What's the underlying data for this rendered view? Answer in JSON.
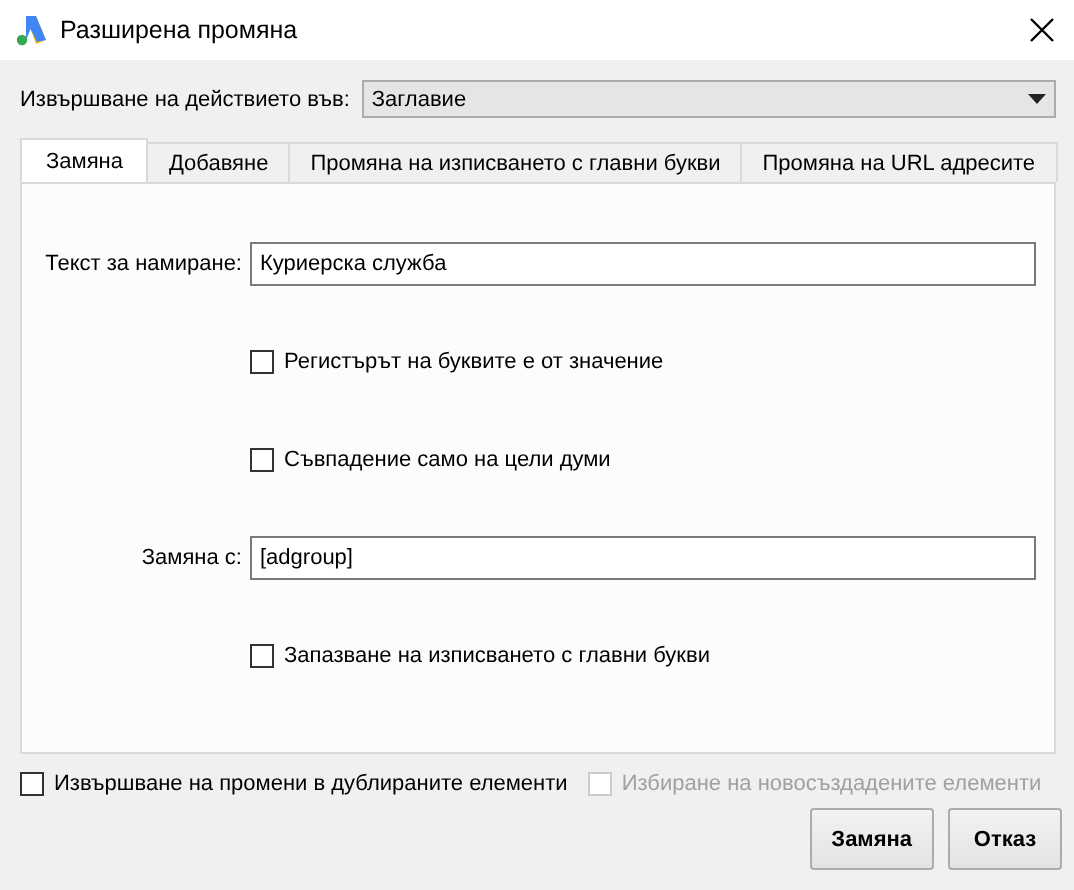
{
  "window": {
    "title": "Разширена промяна"
  },
  "apply_to": {
    "label": "Извършване на действието във:",
    "value": "Заглавие"
  },
  "tabs": [
    {
      "label": "Замяна",
      "selected": true
    },
    {
      "label": "Добавяне",
      "selected": false
    },
    {
      "label": "Промяна на изписването с главни букви",
      "selected": false
    },
    {
      "label": "Промяна на URL адресите",
      "selected": false
    }
  ],
  "fields": [
    {
      "kind": "text",
      "label": "Текст за намиране:",
      "value": "Куриерска служба"
    },
    {
      "kind": "checkbox",
      "label": "Регистърът на буквите е от значение",
      "checked": false
    },
    {
      "kind": "checkbox",
      "label": "Съвпадение само на цели думи",
      "checked": false
    },
    {
      "kind": "text",
      "label": "Замяна с:",
      "value": "[adgroup]"
    },
    {
      "kind": "checkbox",
      "label": "Запазване на изписването с главни букви",
      "checked": false
    }
  ],
  "options": [
    {
      "label": "Извършване на промени в дублираните елементи",
      "checked": false,
      "disabled": false
    },
    {
      "label": "Избиране на новосъздадените елементи",
      "checked": false,
      "disabled": true
    }
  ],
  "buttons": [
    "Замяна",
    "Отказ"
  ]
}
